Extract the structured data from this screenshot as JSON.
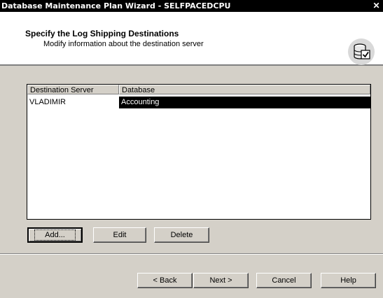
{
  "window": {
    "title": "Database Maintenance Plan Wizard - SELFPACEDCPU",
    "close_glyph": "✕"
  },
  "header": {
    "title": "Specify the Log Shipping Destinations",
    "subtitle": "Modify information about the destination server",
    "icon": "database-check-icon"
  },
  "list": {
    "columns": [
      "Destination Server",
      "Database"
    ],
    "rows": [
      {
        "server": "VLADIMIR",
        "database": "Accounting",
        "selected": true
      }
    ]
  },
  "list_buttons": {
    "add": "Add...",
    "edit": "Edit",
    "delete": "Delete"
  },
  "footer_buttons": {
    "back": "< Back",
    "next": "Next >",
    "cancel": "Cancel",
    "help": "Help"
  },
  "colors": {
    "selection": "#000000",
    "dialog_bg": "#d4d0c8"
  }
}
